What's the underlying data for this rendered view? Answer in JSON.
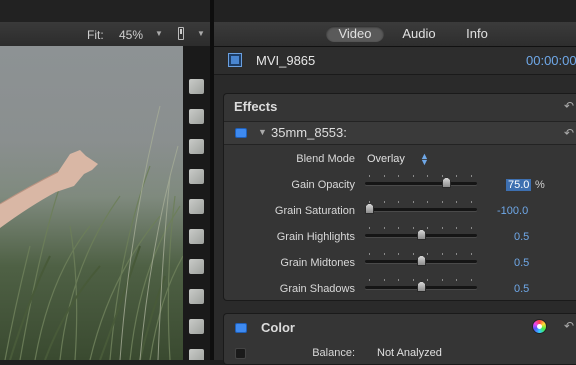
{
  "viewer": {
    "fit_label": "Fit:",
    "fit_value": "45%",
    "icons": [
      "dropdown-arrow-icon",
      "view-options-icon"
    ]
  },
  "inspector": {
    "tabs": [
      {
        "label": "Video",
        "active": true
      },
      {
        "label": "Audio",
        "active": false
      },
      {
        "label": "Info",
        "active": false
      }
    ],
    "clip_name": "MVI_9865",
    "timecode": "00:00:00",
    "effects": {
      "header": "Effects",
      "effect_name": "35mm_8553:",
      "params": {
        "blend_mode": {
          "label": "Blend Mode",
          "value": "Overlay"
        },
        "gain_opacity": {
          "label": "Gain Opacity",
          "value": "75.0",
          "unit": "%",
          "level": 0.75
        },
        "grain_saturation": {
          "label": "Grain Saturation",
          "value": "-100.0",
          "level": 0.0
        },
        "grain_highlights": {
          "label": "Grain Highlights",
          "value": "0.5",
          "level": 0.5
        },
        "grain_midtones": {
          "label": "Grain Midtones",
          "value": "0.5",
          "level": 0.5
        },
        "grain_shadows": {
          "label": "Grain Shadows",
          "value": "0.5",
          "level": 0.5
        }
      }
    },
    "color": {
      "header": "Color",
      "balance_label": "Balance:",
      "balance_value": "Not Analyzed"
    }
  },
  "colors": {
    "accent_blue": "#6fa8e8",
    "checkbox_blue": "#3e8af0",
    "selected_value_bg": "#3d6fb0",
    "panel_bg": "#353535"
  }
}
